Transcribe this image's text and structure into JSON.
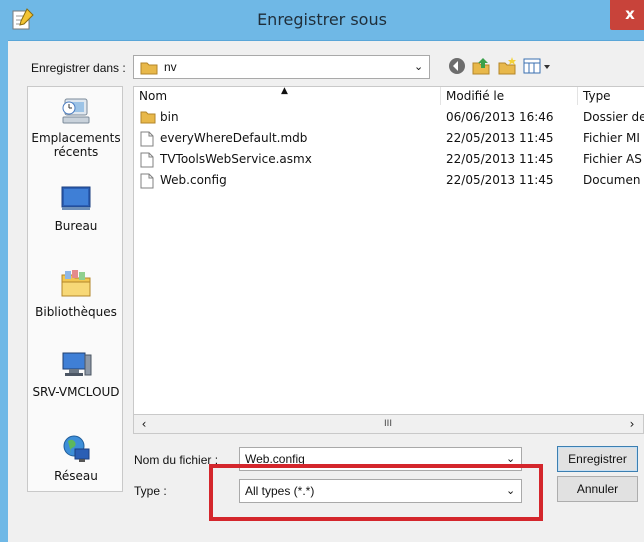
{
  "window": {
    "title": "Enregistrer sous",
    "close_label": "x"
  },
  "location": {
    "label": "Enregistrer dans :",
    "value": "nv"
  },
  "toolbar": {
    "icons": [
      "back-icon",
      "up-folder-icon",
      "new-folder-icon",
      "view-menu-icon"
    ]
  },
  "places": [
    {
      "label": "Emplacements récents",
      "icon": "recent-places-icon"
    },
    {
      "label": "Bureau",
      "icon": "desktop-icon"
    },
    {
      "label": "Bibliothèques",
      "icon": "libraries-icon"
    },
    {
      "label": "SRV-VMCLOUD",
      "icon": "computer-icon"
    },
    {
      "label": "Réseau",
      "icon": "network-icon"
    }
  ],
  "file_list": {
    "columns": {
      "name": "Nom",
      "modified": "Modifié le",
      "type": "Type"
    },
    "rows": [
      {
        "name": "bin",
        "modified": "06/06/2013 16:46",
        "type": "Dossier de",
        "icon": "folder-icon"
      },
      {
        "name": "everyWhereDefault.mdb",
        "modified": "22/05/2013 11:45",
        "type": "Fichier MI",
        "icon": "file-icon"
      },
      {
        "name": "TVToolsWebService.asmx",
        "modified": "22/05/2013 11:45",
        "type": "Fichier AS",
        "icon": "file-icon"
      },
      {
        "name": "Web.config",
        "modified": "22/05/2013 11:45",
        "type": "Documen",
        "icon": "file-icon"
      }
    ],
    "scroll_thumb": "III"
  },
  "filename": {
    "label": "Nom du fichier :",
    "value": "Web.config"
  },
  "filetype": {
    "label": "Type :",
    "value": "All types (*.*)"
  },
  "buttons": {
    "save": "Enregistrer",
    "cancel": "Annuler"
  },
  "colors": {
    "titlebar": "#6fb8e6",
    "close": "#c8433a",
    "highlight": "#d4262c"
  }
}
